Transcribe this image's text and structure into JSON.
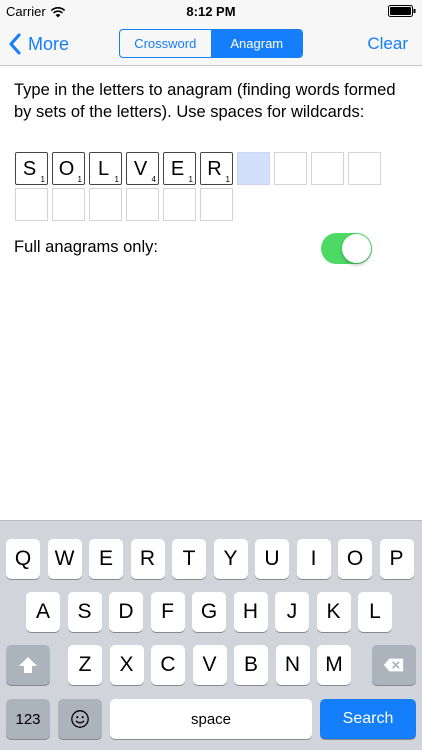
{
  "status_bar": {
    "carrier": "Carrier",
    "time": "8:12 PM",
    "icons": [
      "wifi-icon",
      "battery-icon"
    ]
  },
  "nav": {
    "back_label": "More",
    "segments": [
      "Crossword",
      "Anagram"
    ],
    "selected_segment": "Anagram",
    "clear_label": "Clear"
  },
  "instructions": "Type in the letters to anagram (finding words formed by sets of the letters). Use spaces for wildcards:",
  "tiles": [
    {
      "letter": "S",
      "score": "1"
    },
    {
      "letter": "O",
      "score": "1"
    },
    {
      "letter": "L",
      "score": "1"
    },
    {
      "letter": "V",
      "score": "4"
    },
    {
      "letter": "E",
      "score": "1"
    },
    {
      "letter": "R",
      "score": "1"
    }
  ],
  "empty_tile_count": 10,
  "full_anagrams": {
    "label": "Full anagrams only:",
    "on": true
  },
  "keyboard": {
    "row1": [
      "Q",
      "W",
      "E",
      "R",
      "T",
      "Y",
      "U",
      "I",
      "O",
      "P"
    ],
    "row2": [
      "A",
      "S",
      "D",
      "F",
      "G",
      "H",
      "J",
      "K",
      "L"
    ],
    "row3": [
      "Z",
      "X",
      "C",
      "V",
      "B",
      "N",
      "M"
    ],
    "numbers_label": "123",
    "space_label": "space",
    "search_label": "Search"
  },
  "colors": {
    "accent": "#157efb",
    "toggle_on": "#4cd964",
    "active_tile": "#d3e0fb",
    "keyboard_bg": "#d1d5db"
  }
}
